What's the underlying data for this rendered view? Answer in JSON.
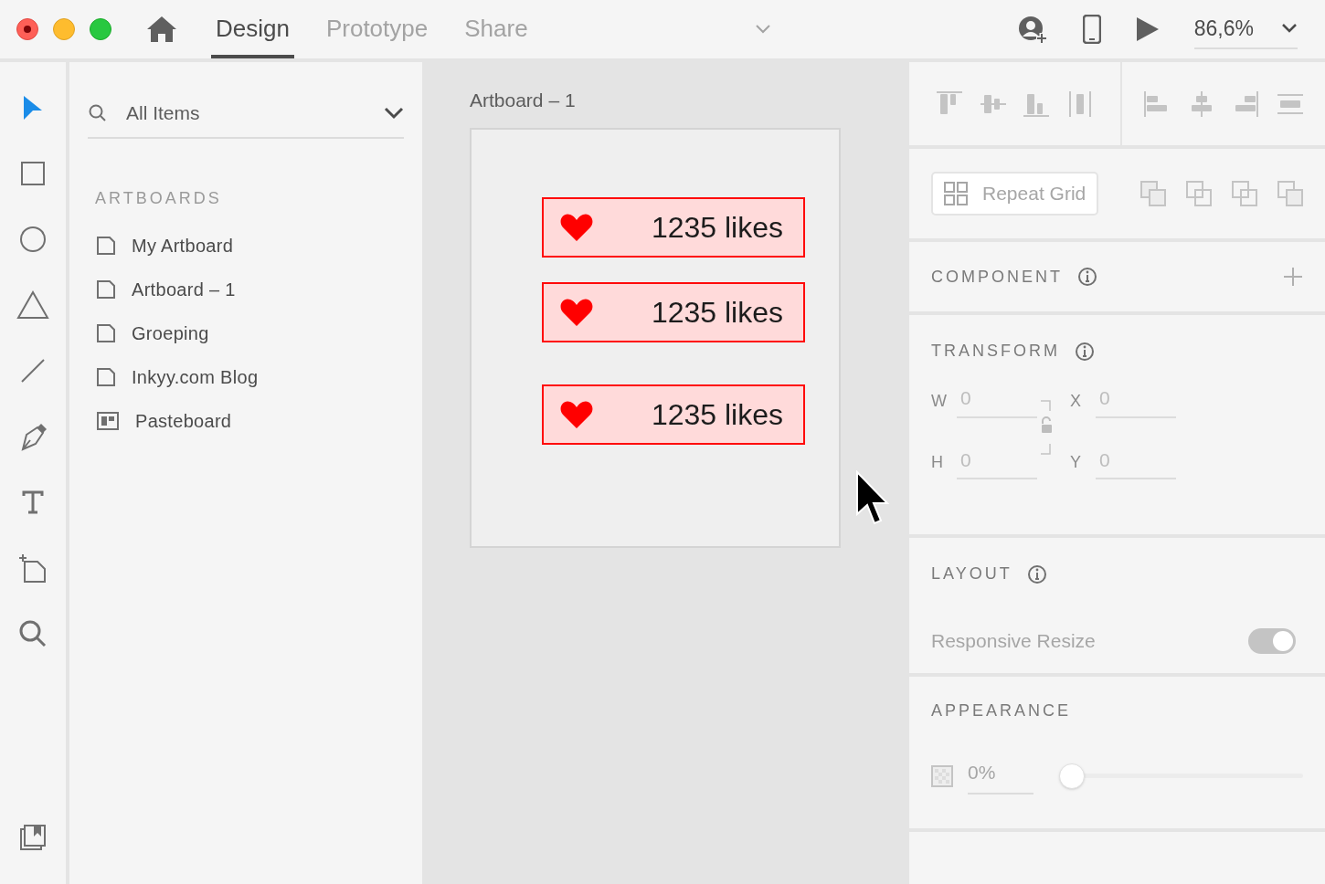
{
  "tabs": [
    {
      "label": "Design",
      "selected": true
    },
    {
      "label": "Prototype",
      "selected": false
    },
    {
      "label": "Share",
      "selected": false
    }
  ],
  "zoom": "86,6%",
  "tools": [
    {
      "kind": "select",
      "selected": true
    },
    {
      "kind": "rectangle",
      "selected": false
    },
    {
      "kind": "ellipse",
      "selected": false
    },
    {
      "kind": "triangle",
      "selected": false
    },
    {
      "kind": "line",
      "selected": false
    },
    {
      "kind": "pen",
      "selected": false
    },
    {
      "kind": "text",
      "selected": false
    },
    {
      "kind": "artboard",
      "selected": false
    },
    {
      "kind": "zoom",
      "selected": false
    }
  ],
  "layers": {
    "search": "All Items",
    "section": "ARTBOARDS",
    "items": [
      {
        "label": "My Artboard",
        "kind": "artboard"
      },
      {
        "label": "Artboard – 1",
        "kind": "artboard"
      },
      {
        "label": "Groeping",
        "kind": "artboard"
      },
      {
        "label": "Inkyy.com Blog",
        "kind": "artboard"
      },
      {
        "label": "Pasteboard",
        "kind": "pasteboard"
      }
    ]
  },
  "canvas": {
    "artboard_title": "Artboard – 1",
    "cards": [
      {
        "text": "1235 likes"
      },
      {
        "text": "1235 likes"
      },
      {
        "text": "1235 likes"
      }
    ]
  },
  "inspector": {
    "repeat_grid": "Repeat Grid",
    "component": "COMPONENT",
    "transform": {
      "title": "TRANSFORM",
      "fields": [
        {
          "label": "W",
          "value": "0"
        },
        {
          "label": "X",
          "value": "0"
        },
        {
          "label": "H",
          "value": "0"
        },
        {
          "label": "Y",
          "value": "0"
        }
      ]
    },
    "layout": {
      "title": "LAYOUT",
      "responsive_resize": {
        "label": "Responsive Resize",
        "on": true
      }
    },
    "appearance": {
      "title": "APPEARANCE",
      "opacity": "0%",
      "level": 0
    }
  }
}
